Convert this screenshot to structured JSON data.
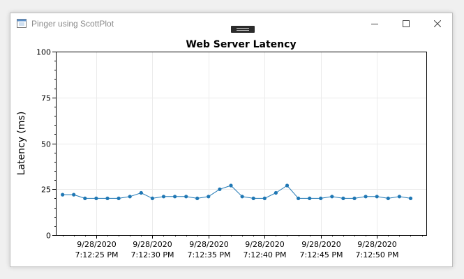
{
  "window": {
    "title": "Pinger using ScottPlot"
  },
  "colors": {
    "series": "#1f77b4",
    "grid": "#ebebeb"
  },
  "chart_data": {
    "type": "scatter",
    "title": "Web Server Latency",
    "xlabel": "",
    "ylabel": "Latency (ms)",
    "ylim": [
      0,
      100
    ],
    "y_ticks": [
      0,
      25,
      50,
      75,
      100
    ],
    "x_time_start": "9/28/2020 7:12:21.4 PM",
    "x_time_end": "9/28/2020 7:12:54.4 PM",
    "x_ticks": [
      {
        "date": "9/28/2020",
        "time": "7:12:25 PM"
      },
      {
        "date": "9/28/2020",
        "time": "7:12:30 PM"
      },
      {
        "date": "9/28/2020",
        "time": "7:12:35 PM"
      },
      {
        "date": "9/28/2020",
        "time": "7:12:40 PM"
      },
      {
        "date": "9/28/2020",
        "time": "7:12:45 PM"
      },
      {
        "date": "9/28/2020",
        "time": "7:12:50 PM"
      }
    ],
    "grid": true,
    "series": [
      {
        "x": [
          "7:12:22 PM",
          "7:12:23 PM",
          "7:12:24 PM",
          "7:12:25 PM",
          "7:12:26 PM",
          "7:12:27 PM",
          "7:12:28 PM",
          "7:12:29 PM",
          "7:12:30 PM",
          "7:12:31 PM",
          "7:12:32 PM",
          "7:12:33 PM",
          "7:12:34 PM",
          "7:12:35 PM",
          "7:12:36 PM",
          "7:12:37 PM",
          "7:12:38 PM",
          "7:12:39 PM",
          "7:12:40 PM",
          "7:12:41 PM",
          "7:12:42 PM",
          "7:12:43 PM",
          "7:12:44 PM",
          "7:12:45 PM",
          "7:12:46 PM",
          "7:12:47 PM",
          "7:12:48 PM",
          "7:12:49 PM",
          "7:12:50 PM",
          "7:12:51 PM",
          "7:12:52 PM",
          "7:12:53 PM"
        ],
        "values": [
          22,
          22,
          20,
          20,
          20,
          20,
          21,
          23,
          20,
          21,
          21,
          21,
          20,
          21,
          25,
          27,
          21,
          20,
          20,
          23,
          27,
          20,
          20,
          20,
          21,
          20,
          20,
          21,
          21,
          20,
          21,
          20
        ]
      }
    ]
  }
}
